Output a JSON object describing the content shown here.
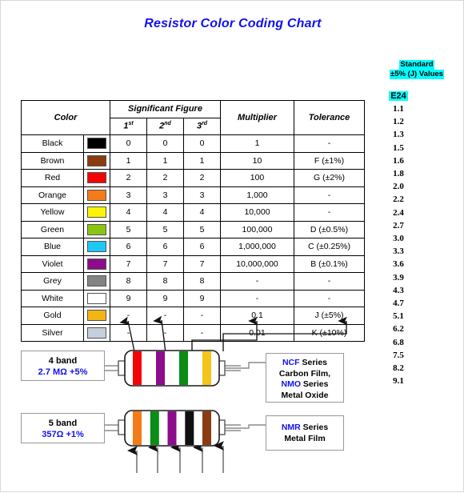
{
  "title": "Resistor Color Coding Chart",
  "standard_values": {
    "header_line1": "Standard",
    "header_line2": "±5% (J) Values",
    "series_name": "E24",
    "values": [
      "1.1",
      "1.2",
      "1.3",
      "1.5",
      "1.6",
      "1.8",
      "2.0",
      "2.2",
      "2.4",
      "2.7",
      "3.0",
      "3.3",
      "3.6",
      "3.9",
      "4.3",
      "4.7",
      "5.1",
      "6.2",
      "6.8",
      "7.5",
      "8.2",
      "9.1"
    ],
    "highlight_color": "#00ffff"
  },
  "table": {
    "headers": {
      "color": "Color",
      "significant_figure": "Significant Figure",
      "first": "1",
      "first_sup": "st",
      "second": "2",
      "second_sup": "nd",
      "third": "3",
      "third_sup": "rd",
      "multiplier": "Multiplier",
      "tolerance": "Tolerance"
    },
    "rows": [
      {
        "name": "Black",
        "swatch": "#000000",
        "d1": "0",
        "d2": "0",
        "d3": "0",
        "multiplier": "1",
        "tolerance": "-"
      },
      {
        "name": "Brown",
        "swatch": "#8a3b10",
        "d1": "1",
        "d2": "1",
        "d3": "1",
        "multiplier": "10",
        "tolerance": "F (±1%)"
      },
      {
        "name": "Red",
        "swatch": "#f40505",
        "d1": "2",
        "d2": "2",
        "d3": "2",
        "multiplier": "100",
        "tolerance": "G (±2%)"
      },
      {
        "name": "Orange",
        "swatch": "#f47b18",
        "d1": "3",
        "d2": "3",
        "d3": "3",
        "multiplier": "1,000",
        "tolerance": "-"
      },
      {
        "name": "Yellow",
        "swatch": "#fcf404",
        "d1": "4",
        "d2": "4",
        "d3": "4",
        "multiplier": "10,000",
        "tolerance": "-"
      },
      {
        "name": "Green",
        "swatch": "#8cc412",
        "d1": "5",
        "d2": "5",
        "d3": "5",
        "multiplier": "100,000",
        "tolerance": "D (±0.5%)"
      },
      {
        "name": "Blue",
        "swatch": "#1ec8f4",
        "d1": "6",
        "d2": "6",
        "d3": "6",
        "multiplier": "1,000,000",
        "tolerance": "C (±0.25%)"
      },
      {
        "name": "Violet",
        "swatch": "#8c0c8c",
        "d1": "7",
        "d2": "7",
        "d3": "7",
        "multiplier": "10,000,000",
        "tolerance": "B (±0.1%)"
      },
      {
        "name": "Grey",
        "swatch": "#848484",
        "d1": "8",
        "d2": "8",
        "d3": "8",
        "multiplier": "-",
        "tolerance": "-"
      },
      {
        "name": "White",
        "swatch": "#ffffff",
        "d1": "9",
        "d2": "9",
        "d3": "9",
        "multiplier": "-",
        "tolerance": "-"
      },
      {
        "name": "Gold",
        "swatch": "#f4b414",
        "d1": "-",
        "d2": "-",
        "d3": "-",
        "multiplier": "0.1",
        "tolerance": "J (±5%)"
      },
      {
        "name": "Silver",
        "swatch": "#c4d0dc",
        "d1": "-",
        "d2": "-",
        "d3": "-",
        "multiplier": "0.01",
        "tolerance": "K (±10%)"
      }
    ]
  },
  "resistors": [
    {
      "id": "four-band",
      "label_line1": "4 band",
      "label_line2": "2.7 MΩ +5%",
      "bands": [
        {
          "name": "red",
          "color": "#f40505"
        },
        {
          "name": "violet",
          "color": "#8c0c8c"
        },
        {
          "name": "green",
          "color": "#0a8c16"
        },
        {
          "name": "gold",
          "color": "#f4c41a"
        }
      ],
      "series_lines": [
        "NCF Series",
        "Carbon Film,",
        "NMO Series",
        "Metal Oxide"
      ],
      "series_bold": [
        "NCF",
        "NMO"
      ]
    },
    {
      "id": "five-band",
      "label_line1": "5 band",
      "label_line2": "357Ω +1%",
      "bands": [
        {
          "name": "orange",
          "color": "#f47b18"
        },
        {
          "name": "green",
          "color": "#0a8c16"
        },
        {
          "name": "violet",
          "color": "#8c0c8c"
        },
        {
          "name": "black",
          "color": "#101010"
        },
        {
          "name": "brown",
          "color": "#8a3b10"
        }
      ],
      "series_lines": [
        "NMR Series",
        "Metal Film"
      ],
      "series_bold": [
        "NMR"
      ]
    }
  ],
  "series_boxes": {
    "ncf": {
      "line1_bold": "NCF",
      "line1_rest": " Series",
      "line2": "Carbon Film,",
      "line3_bold": "NMO",
      "line3_rest": " Series",
      "line4": "Metal Oxide"
    },
    "nmr": {
      "line1_bold": "NMR",
      "line1_rest": " Series",
      "line2": "Metal Film"
    }
  }
}
